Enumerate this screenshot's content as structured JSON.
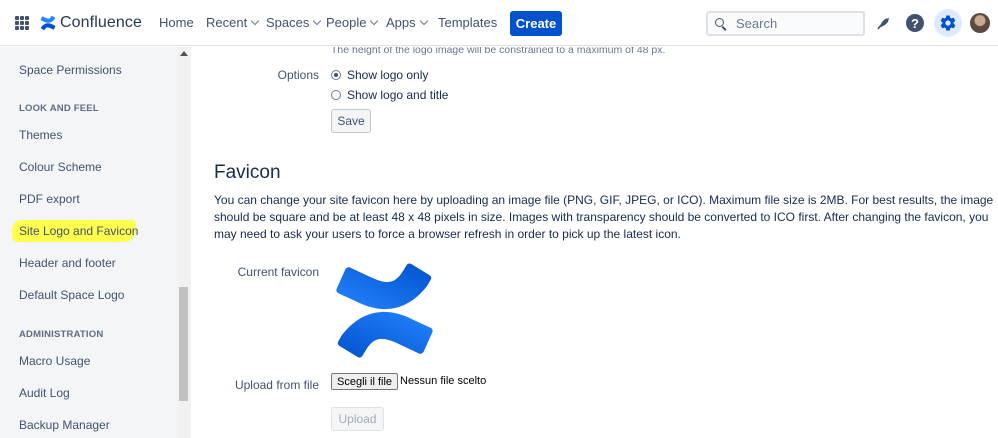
{
  "topnav": {
    "app_name": "Confluence",
    "items": [
      {
        "label": "Home",
        "dropdown": false
      },
      {
        "label": "Recent",
        "dropdown": true
      },
      {
        "label": "Spaces",
        "dropdown": true
      },
      {
        "label": "People",
        "dropdown": true
      },
      {
        "label": "Apps",
        "dropdown": true
      },
      {
        "label": "Templates",
        "dropdown": false
      }
    ],
    "create_label": "Create",
    "search_placeholder": "Search",
    "icons": [
      "app-switcher-icon",
      "confluence-logo-icon",
      "search-icon",
      "notifications-icon",
      "help-icon",
      "settings-icon",
      "avatar"
    ],
    "brand_color": "#0052cc"
  },
  "sidebar": {
    "items_top": [
      "Space Permissions"
    ],
    "look_and_feel_heading": "LOOK AND FEEL",
    "look_and_feel": [
      "Themes",
      "Colour Scheme",
      "PDF export",
      "Site Logo and Favicon",
      "Header and footer",
      "Default Space Logo"
    ],
    "administration_heading": "ADMINISTRATION",
    "administration": [
      "Macro Usage",
      "Audit Log",
      "Backup Manager"
    ],
    "highlighted_item": "Site Logo and Favicon",
    "highlight_color": "#ffff3a"
  },
  "logo_section": {
    "hint": "The height of the logo image will be constrained to a maximum of 48 px.",
    "options_label": "Options",
    "options": [
      {
        "label": "Show logo only",
        "checked": true
      },
      {
        "label": "Show logo and title",
        "checked": false
      }
    ],
    "save_label": "Save"
  },
  "favicon_section": {
    "title": "Favicon",
    "description": "You can change your site favicon here by uploading an image file (PNG, GIF, JPEG, or ICO). Maximum file size is 2MB. For best results, the image should be square and be at least 48 x 48 pixels in size. Images with transparency should be converted to ICO first. After changing the favicon, you may need to ask your users to force a browser refresh in order to pick up the latest icon.",
    "current_favicon_label": "Current favicon",
    "upload_label": "Upload from file",
    "choose_file_label": "Scegli il file",
    "no_file_label": "Nessun file scelto",
    "upload_button_label": "Upload"
  }
}
